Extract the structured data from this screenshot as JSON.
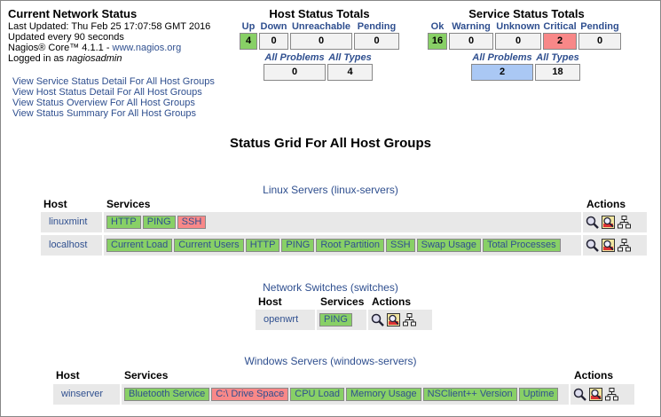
{
  "info": {
    "title": "Current Network Status",
    "last_updated": "Last Updated: Thu Feb 25 17:07:58 GMT 2016",
    "update_freq": "Updated every 90 seconds",
    "core_prefix": "Nagios® Core™ 4.1.1 - ",
    "core_link": "www.nagios.org",
    "logged_prefix": "Logged in as ",
    "logged_user": "nagiosadmin"
  },
  "links": [
    "View Service Status Detail For All Host Groups",
    "View Host Status Detail For All Host Groups",
    "View Status Overview For All Host Groups",
    "View Status Summary For All Host Groups"
  ],
  "host_totals": {
    "title": "Host Status Totals",
    "headers": [
      "Up",
      "Down",
      "Unreachable",
      "Pending"
    ],
    "values": [
      "4",
      "0",
      "0",
      "0"
    ],
    "sub_headers": [
      "All Problems",
      "All Types"
    ],
    "sub_values": [
      "0",
      "4"
    ]
  },
  "service_totals": {
    "title": "Service Status Totals",
    "headers": [
      "Ok",
      "Warning",
      "Unknown",
      "Critical",
      "Pending"
    ],
    "values": [
      "16",
      "0",
      "0",
      "2",
      "0"
    ],
    "sub_headers": [
      "All Problems",
      "All Types"
    ],
    "sub_values": [
      "2",
      "18"
    ]
  },
  "grid_title": "Status Grid For All Host Groups",
  "columns": {
    "host": "Host",
    "services": "Services",
    "actions": "Actions"
  },
  "groups": [
    {
      "title": "Linux Servers (linux-servers)",
      "rows": [
        {
          "host": "linuxmint",
          "services": [
            "HTTP",
            "PING",
            "SSH"
          ]
        },
        {
          "host": "localhost",
          "services": [
            "Current Load",
            "Current Users",
            "HTTP",
            "PING",
            "Root Partition",
            "SSH",
            "Swap Usage",
            "Total Processes"
          ]
        }
      ]
    },
    {
      "title": "Network Switches (switches)",
      "rows": [
        {
          "host": "openwrt",
          "services": [
            "PING"
          ]
        }
      ]
    },
    {
      "title": "Windows Servers (windows-servers)",
      "rows": [
        {
          "host": "winserver",
          "services": [
            "Bluetooth Service",
            "C:\\ Drive Space",
            "CPU Load",
            "Memory Usage",
            "NSClient++ Version",
            "Uptime"
          ]
        }
      ]
    }
  ],
  "colors": {
    "ok": "#88d066",
    "critical": "#f88888",
    "problems": "#aac8f4",
    "link": "#2f4f8f",
    "cell": "#e8e8e8"
  },
  "action_icons": [
    "magnifier-icon",
    "status-map-icon",
    "network-map-icon"
  ]
}
